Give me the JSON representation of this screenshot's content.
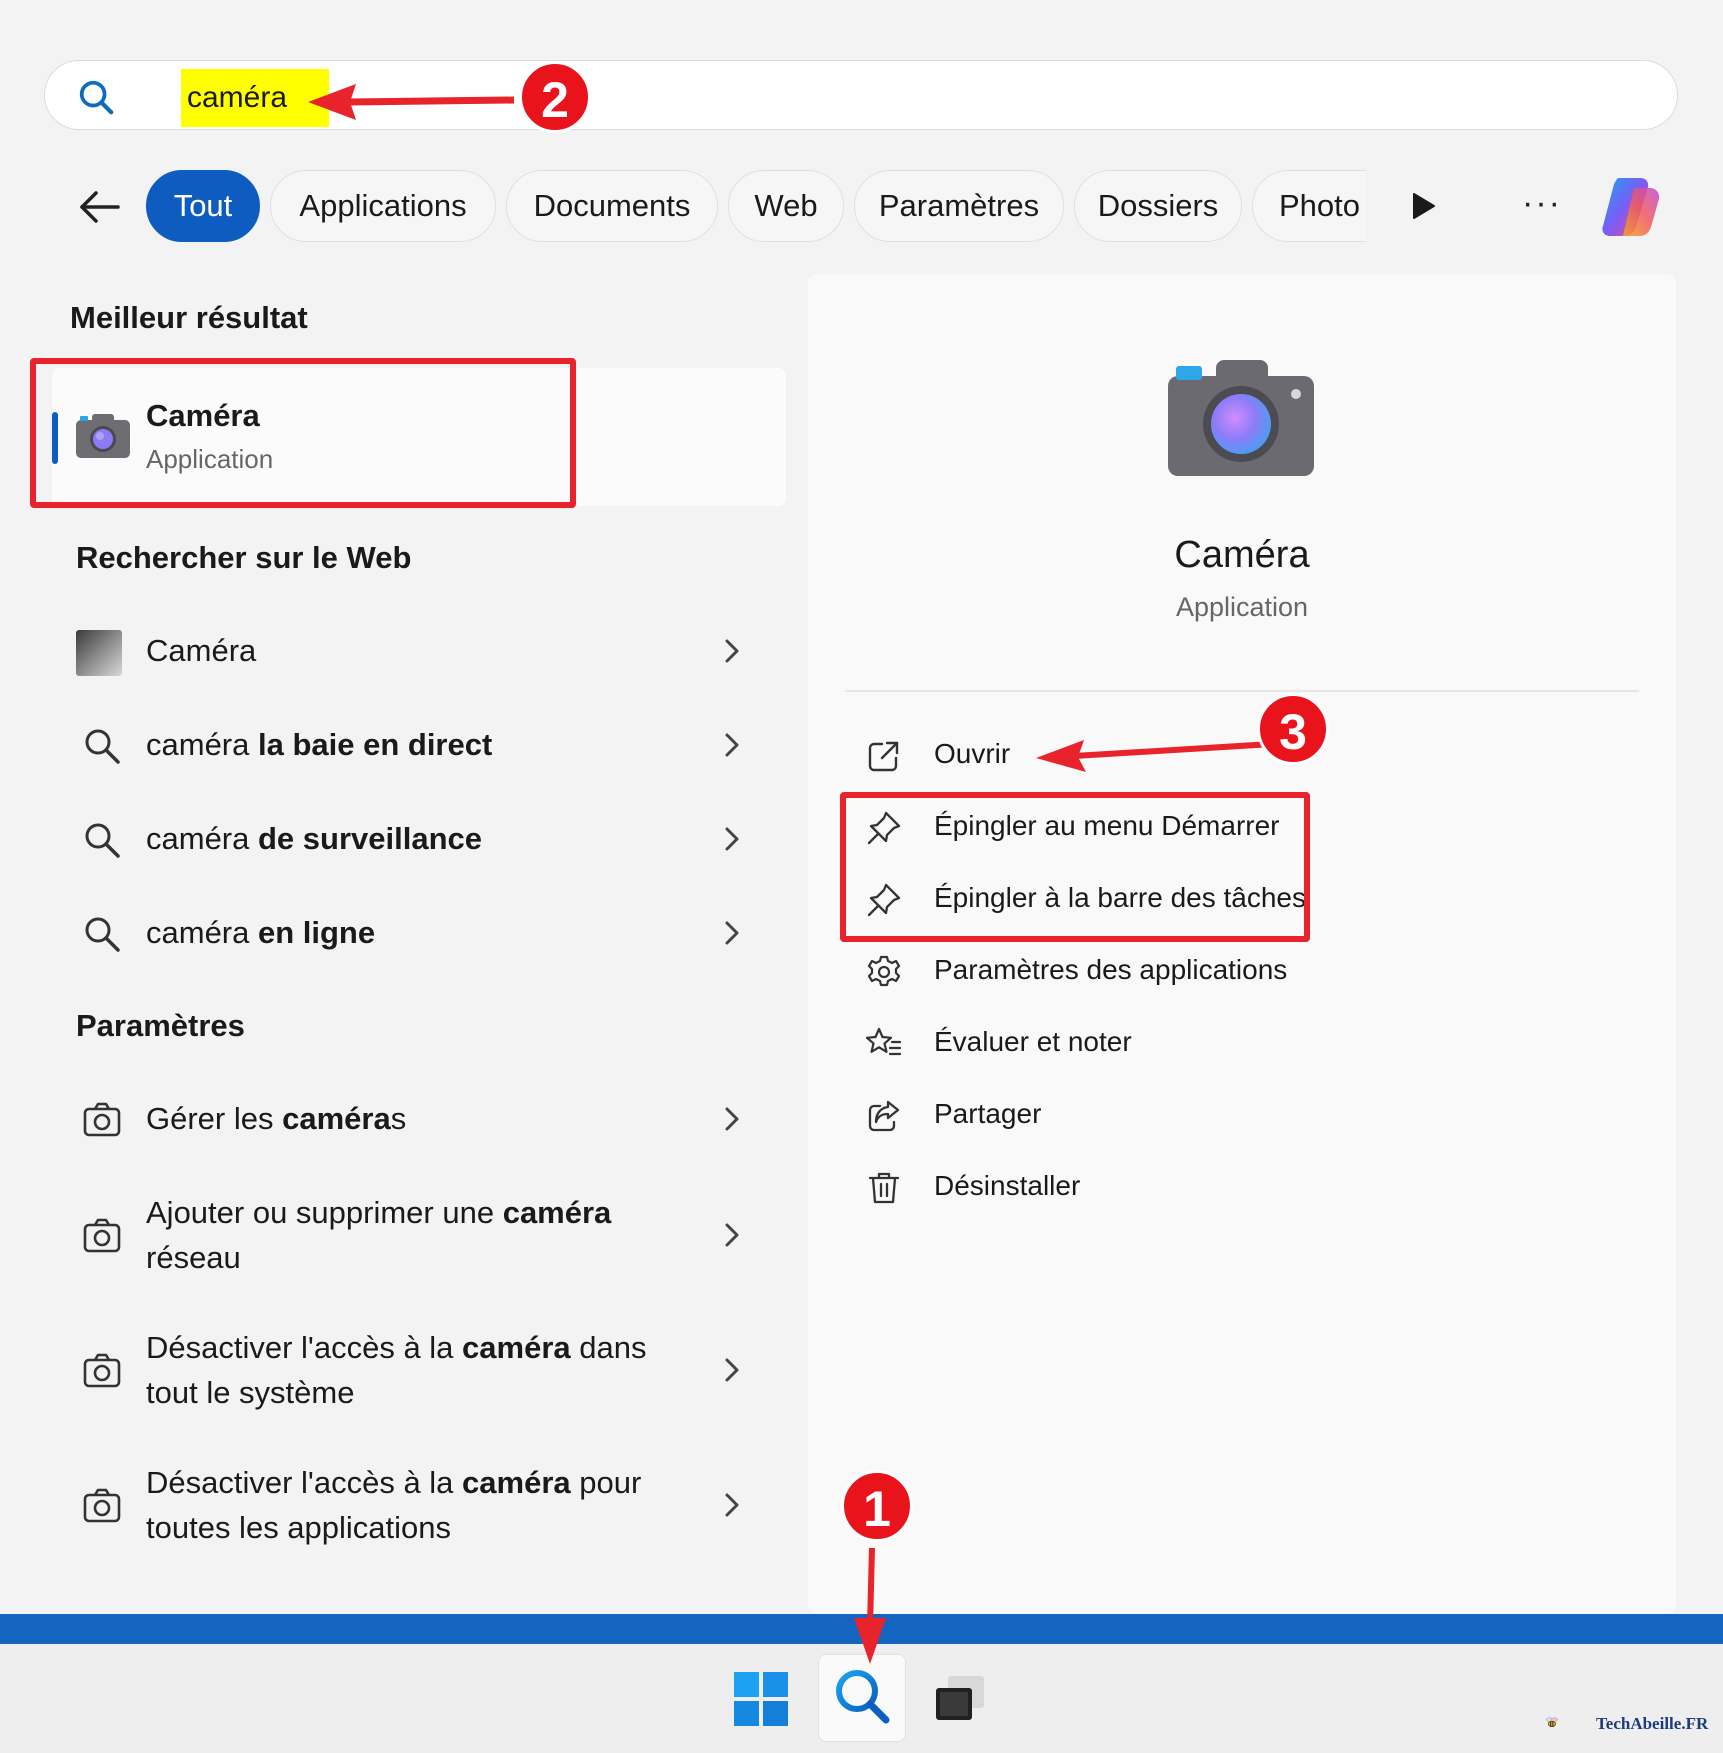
{
  "search": {
    "query": "caméra"
  },
  "annotations": {
    "badge1": "1",
    "badge2": "2",
    "badge3": "3"
  },
  "tabs": {
    "items": [
      {
        "label": "Tout"
      },
      {
        "label": "Applications"
      },
      {
        "label": "Documents"
      },
      {
        "label": "Web"
      },
      {
        "label": "Paramètres"
      },
      {
        "label": "Dossiers"
      },
      {
        "label": "Photo"
      }
    ],
    "more": "···"
  },
  "best": {
    "heading": "Meilleur résultat",
    "title": "Caméra",
    "subtitle": "Application"
  },
  "web": {
    "heading": "Rechercher sur le Web",
    "items": [
      {
        "plain": "Caméra",
        "bold": ""
      },
      {
        "plain": "caméra ",
        "bold": "la baie en direct"
      },
      {
        "plain": "caméra ",
        "bold": "de surveillance"
      },
      {
        "plain": "caméra ",
        "bold": "en ligne"
      }
    ]
  },
  "settings": {
    "heading": "Paramètres",
    "items": [
      {
        "pre": "Gérer les ",
        "bold": "caméra",
        "post": "s"
      },
      {
        "pre": "Ajouter ou supprimer une ",
        "bold": "caméra",
        "post": " réseau"
      },
      {
        "pre": "Désactiver l'accès à la ",
        "bold": "caméra",
        "post": " dans tout le système"
      },
      {
        "pre": "Désactiver l'accès à la ",
        "bold": "caméra",
        "post": " pour toutes les applications"
      }
    ]
  },
  "details": {
    "title": "Caméra",
    "subtitle": "Application",
    "actions": [
      {
        "label": "Ouvrir",
        "icon": "open-external-icon"
      },
      {
        "label": "Épingler au menu Démarrer",
        "icon": "pin-icon"
      },
      {
        "label": "Épingler à la barre des tâches",
        "icon": "pin-icon"
      },
      {
        "label": "Paramètres des applications",
        "icon": "gear-icon"
      },
      {
        "label": "Évaluer et noter",
        "icon": "star-list-icon"
      },
      {
        "label": "Partager",
        "icon": "share-icon"
      },
      {
        "label": "Désinstaller",
        "icon": "trash-icon"
      }
    ]
  },
  "watermark": {
    "text": "TechAbeille.FR"
  },
  "colors": {
    "accent": "#0f5cc0",
    "annotation_red": "#e8131b",
    "highlight": "#ffff00"
  }
}
